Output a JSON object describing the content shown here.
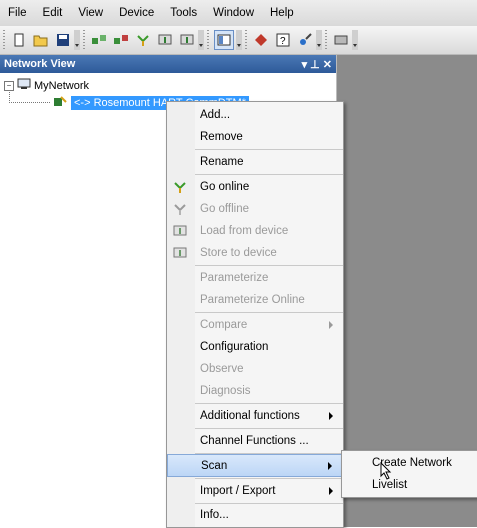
{
  "menubar": [
    "File",
    "Edit",
    "View",
    "Device",
    "Tools",
    "Window",
    "Help"
  ],
  "panel": {
    "title": "Network View",
    "pin": "▾ ⊥ ✕"
  },
  "tree": {
    "root": {
      "label": "MyNetwork",
      "expander": "−"
    },
    "child": {
      "label": "<-> Rosemount HART CommDTM*"
    }
  },
  "context_menu": {
    "items": [
      {
        "label": "Add...",
        "enabled": true
      },
      {
        "label": "Remove",
        "enabled": true
      },
      {
        "label": "Rename",
        "enabled": true
      },
      {
        "label": "Go online",
        "enabled": true,
        "icon": "go-online-icon"
      },
      {
        "label": "Go offline",
        "enabled": false,
        "icon": "go-offline-icon"
      },
      {
        "label": "Load from device",
        "enabled": false,
        "icon": "load-from-device-icon"
      },
      {
        "label": "Store to device",
        "enabled": false,
        "icon": "store-to-device-icon"
      },
      {
        "label": "Parameterize",
        "enabled": false
      },
      {
        "label": "Parameterize Online",
        "enabled": false
      },
      {
        "label": "Compare",
        "enabled": false,
        "submenu": true
      },
      {
        "label": "Configuration",
        "enabled": true
      },
      {
        "label": "Observe",
        "enabled": false
      },
      {
        "label": "Diagnosis",
        "enabled": false
      },
      {
        "label": "Additional functions",
        "enabled": true,
        "submenu": true
      },
      {
        "label": "Channel Functions ...",
        "enabled": true
      },
      {
        "label": "Scan",
        "enabled": true,
        "submenu": true,
        "highlighted": true
      },
      {
        "label": "Import / Export",
        "enabled": true,
        "submenu": true
      },
      {
        "label": "Info...",
        "enabled": true
      }
    ]
  },
  "submenu": {
    "items": [
      {
        "label": "Create Network",
        "highlighted": true
      },
      {
        "label": "Livelist"
      }
    ]
  },
  "colors": {
    "title_bar": "#3a68a8",
    "selection": "#3399ff",
    "highlight": "#cfe2f9",
    "workspace": "#8b8b8b"
  }
}
